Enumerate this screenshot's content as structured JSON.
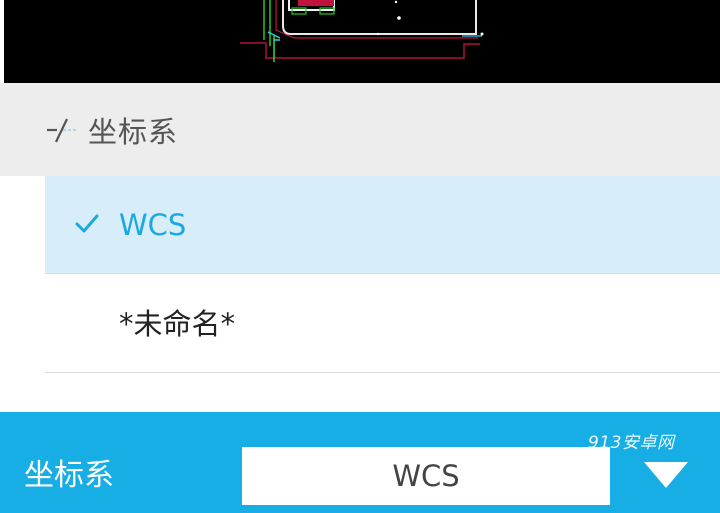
{
  "header": {
    "title": "坐标系",
    "icon": "ucs-axis-icon"
  },
  "options": [
    {
      "label": "WCS",
      "selected": true
    },
    {
      "label": "*未命名*",
      "selected": false
    }
  ],
  "toolbar": {
    "label": "坐标系",
    "current_value": "WCS",
    "dropdown_icon": "triangle-down-icon"
  },
  "watermark": "913安卓网",
  "colors": {
    "accent": "#17ade5",
    "selected_bg": "#d7eefa",
    "selected_text": "#1ba9e0",
    "header_bg": "#ededed",
    "canvas_bg": "#000000"
  }
}
